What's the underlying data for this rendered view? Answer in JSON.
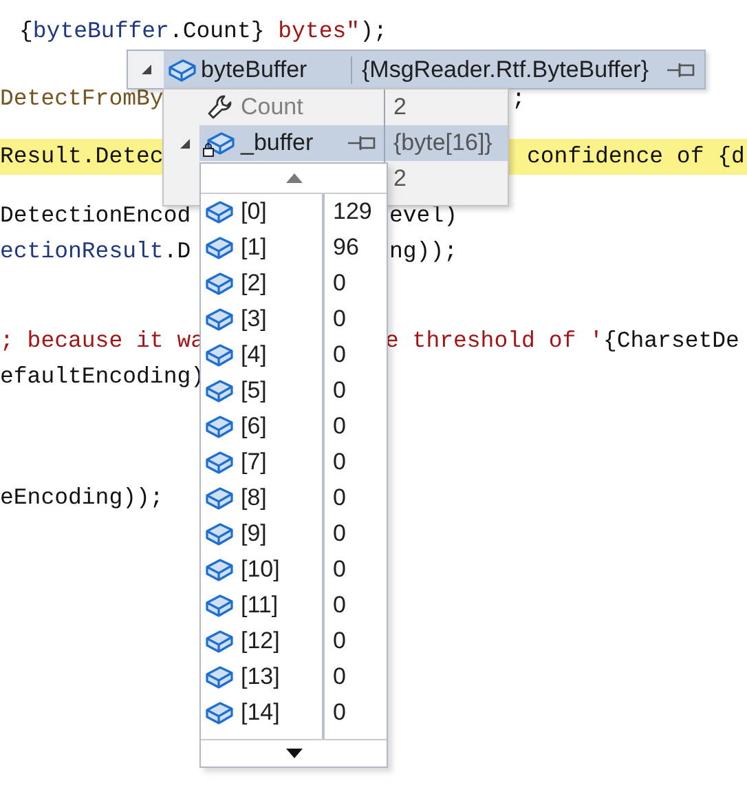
{
  "code_lines": [
    {
      "highlighted": false,
      "pieces": [
        [
          {
            "kind": "plain",
            "text": "{"
          },
          {
            "kind": "identifier",
            "text": "byteBuffer"
          },
          {
            "kind": "plain",
            "text": ".Count} "
          },
          {
            "kind": "string",
            "text": "bytes\""
          },
          {
            "kind": "plain",
            "text": ");"
          }
        ]
      ]
    },
    {
      "highlighted": false,
      "pieces": [
        [
          {
            "kind": "method",
            "text": "DetectFromBy"
          }
        ],
        [
          {
            "kind": "plain",
            "text": ";"
          }
        ]
      ]
    },
    {
      "highlighted": true,
      "pieces": [
        [
          {
            "kind": "plain",
            "text": "Result.Detec"
          }
        ],
        [
          {
            "kind": "plain",
            "text": "confidence of {d"
          }
        ]
      ]
    },
    {
      "highlighted": false,
      "pieces": [
        [
          {
            "kind": "plain",
            "text": "DetectionEncod"
          }
        ],
        [
          {
            "kind": "plain",
            "text": "evel)"
          }
        ]
      ]
    },
    {
      "highlighted": false,
      "pieces": [
        [
          {
            "kind": "identifier",
            "text": "ectionResult"
          },
          {
            "kind": "plain",
            "text": ".D"
          }
        ],
        [
          {
            "kind": "plain",
            "text": "ng));"
          }
        ]
      ]
    },
    {
      "highlighted": false,
      "pieces": [
        [
          {
            "kind": "string",
            "text": "; because it wa"
          }
        ],
        [
          {
            "kind": "string",
            "text": "e threshold of '"
          },
          {
            "kind": "plain",
            "text": "{CharsetDe"
          }
        ]
      ]
    },
    {
      "highlighted": false,
      "pieces": [
        [
          {
            "kind": "plain",
            "text": "efaultEncoding)"
          }
        ]
      ]
    },
    {
      "highlighted": false,
      "pieces": [
        [
          {
            "kind": "plain",
            "text": "eEncoding));"
          }
        ]
      ]
    }
  ],
  "datatip": {
    "name": "byteBuffer",
    "value": "{MsgReader.Rtf.ByteBuffer}",
    "expanded": true,
    "selected": true,
    "children": [
      {
        "kind": "property",
        "name": "Count",
        "value": "2",
        "selected": false
      },
      {
        "kind": "field",
        "name": "_buffer",
        "value": "{byte[16]}",
        "selected": true,
        "expanded": true
      },
      {
        "kind": "hidden",
        "value": "2",
        "selected": false
      }
    ],
    "elements": [
      {
        "name": "[0]",
        "value": "129"
      },
      {
        "name": "[1]",
        "value": "96"
      },
      {
        "name": "[2]",
        "value": "0"
      },
      {
        "name": "[3]",
        "value": "0"
      },
      {
        "name": "[4]",
        "value": "0"
      },
      {
        "name": "[5]",
        "value": "0"
      },
      {
        "name": "[6]",
        "value": "0"
      },
      {
        "name": "[7]",
        "value": "0"
      },
      {
        "name": "[8]",
        "value": "0"
      },
      {
        "name": "[9]",
        "value": "0"
      },
      {
        "name": "[10]",
        "value": "0"
      },
      {
        "name": "[11]",
        "value": "0"
      },
      {
        "name": "[12]",
        "value": "0"
      },
      {
        "name": "[13]",
        "value": "0"
      },
      {
        "name": "[14]",
        "value": "0"
      }
    ]
  }
}
